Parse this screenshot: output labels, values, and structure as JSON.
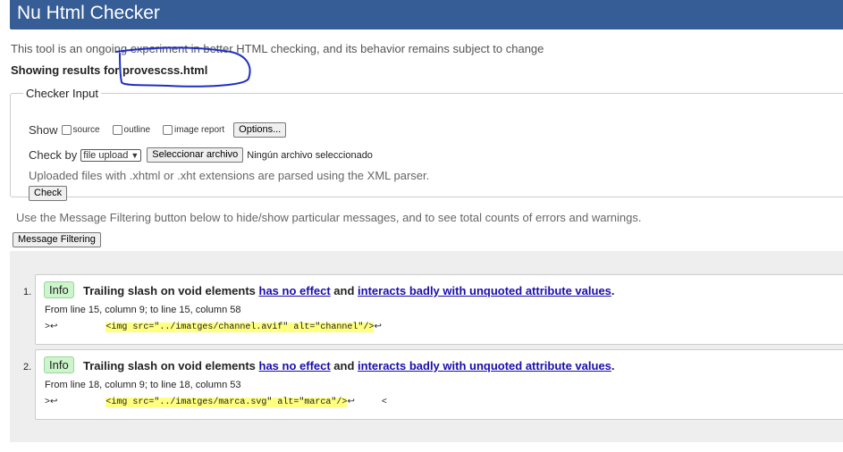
{
  "header": {
    "title": "Nu Html Checker"
  },
  "intro": "This tool is an ongoing experiment in better HTML checking, and its behavior remains subject to change",
  "showing": {
    "prefix": "Showing results for ",
    "file": "provescss.html"
  },
  "checker": {
    "legend": "Checker Input",
    "show_label": "Show",
    "options": [
      "source",
      "outline",
      "image report"
    ],
    "options_button": "Options...",
    "checkby_label": "Check by",
    "checkby_value": "file upload",
    "choose_file": "Seleccionar archivo",
    "no_file": "Ningún archivo seleccionado",
    "note": "Uploaded files with .xhtml or .xht extensions are parsed using the XML parser.",
    "check_button": "Check"
  },
  "filter": {
    "text": "Use the Message Filtering button below to hide/show particular messages, and to see total counts of errors and warnings.",
    "button": "Message Filtering"
  },
  "messages": [
    {
      "num": "1.",
      "type": "Info",
      "text1": "Trailing slash on void elements ",
      "link1": "has no effect",
      "text2": " and ",
      "link2": "interacts badly with unquoted attribute values",
      "text3": ".",
      "location": "From line 15, column 9; to line 15, column 58",
      "code_pre": ">↩         ",
      "code_hl": "<img src=\"../imatges/channel.avif\" alt=\"channel\"/>",
      "code_post": "↩"
    },
    {
      "num": "2.",
      "type": "Info",
      "text1": "Trailing slash on void elements ",
      "link1": "has no effect",
      "text2": " and ",
      "link2": "interacts badly with unquoted attribute values",
      "text3": ".",
      "location": "From line 18, column 9; to line 18, column 53",
      "code_pre": ">↩         ",
      "code_hl": "<img src=\"../imatges/marca.svg\" alt=\"marca\"/>",
      "code_post": "↩     <"
    }
  ],
  "colors": {
    "header": "#365d95",
    "info_badge": "#ccf5cc",
    "highlight": "#ffff80",
    "scribble": "#1f2fc4"
  }
}
